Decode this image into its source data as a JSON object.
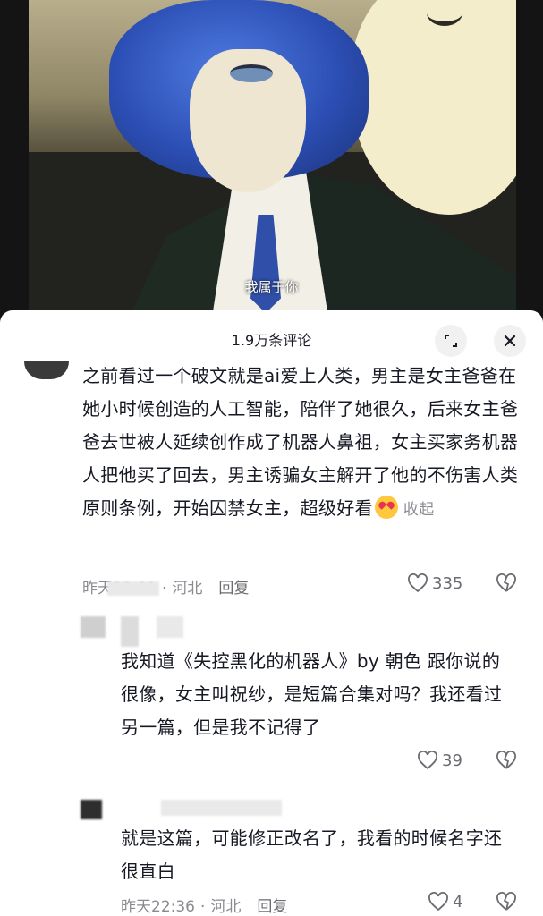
{
  "video": {
    "subtitle": "我属于你"
  },
  "comments_sheet": {
    "title": "1.9万条评论",
    "expand_icon": "expand-icon",
    "close_icon": "close-icon"
  },
  "comments": [
    {
      "text": "之前看过一个破文就是ai爱上人类，男主是女主爸爸在她小时候创造的人工智能，陪伴了她很久，后来女主爸爸去世被人延续创作成了机器人鼻祖，女主买家务机器人把他买了回去，男主诱骗女主解开了他的不伤害人类原则条例，开始囚禁女主，超级好看",
      "emoji": "heart-eyes-emoji",
      "collapse_label": "收起",
      "time": "昨天22:01",
      "location": "河北",
      "reply_label": "回复",
      "likes": "335"
    },
    {
      "text": "我知道《失控黑化的机器人》by 朝色 跟你说的很像，女主叫祝纱，是短篇合集对吗？我还看过另一篇，但是我不记得了",
      "likes": "39"
    },
    {
      "text": "就是这篇，可能修正改名了，我看的时候名字还很直白",
      "time": "昨天22:36",
      "location": "河北",
      "reply_label": "回复",
      "likes": "4"
    }
  ],
  "colors": {
    "text": "#161823",
    "muted": "#8a8b91",
    "sheet_bg": "#ffffff"
  }
}
